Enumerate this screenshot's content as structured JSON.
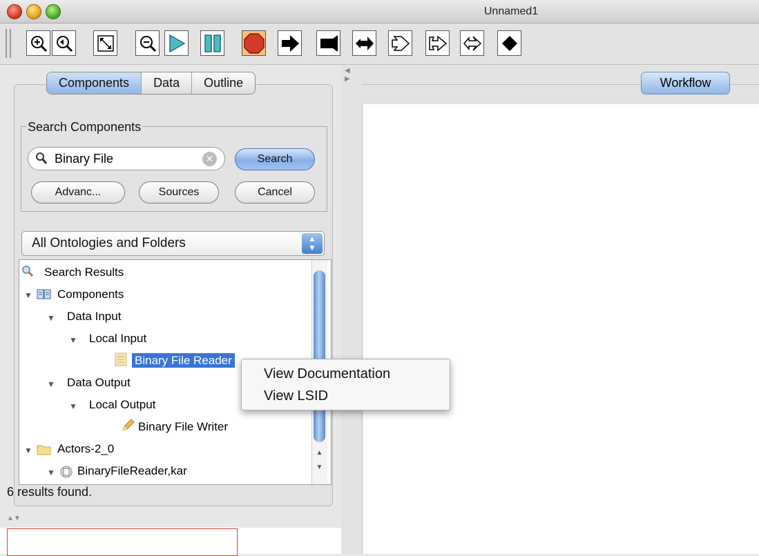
{
  "window": {
    "title": "Unnamed1"
  },
  "toolbar": {
    "buttons": [
      {
        "icon": "zoom-in-icon"
      },
      {
        "icon": "zoom-reset-icon"
      },
      {
        "icon": "zoom-fit-icon"
      },
      {
        "icon": "zoom-out-icon"
      },
      {
        "icon": "run-icon"
      },
      {
        "icon": "pause-icon"
      },
      {
        "icon": "stop-icon"
      },
      {
        "icon": "arrow-right-icon"
      },
      {
        "icon": "flag-icon"
      },
      {
        "icon": "arrow-double-icon"
      },
      {
        "icon": "outline-arrow-icon"
      },
      {
        "icon": "outline-arrow-flag-icon"
      },
      {
        "icon": "outline-double-arrow-icon"
      },
      {
        "icon": "diamond-icon"
      }
    ]
  },
  "left_panel": {
    "tabs": [
      "Components",
      "Data",
      "Outline"
    ],
    "selected_tab": "Components",
    "search": {
      "group_title": "Search Components",
      "value": "Binary File",
      "search_button": "Search",
      "advanced_button": "Advanc...",
      "sources_button": "Sources",
      "cancel_button": "Cancel"
    },
    "ontology_select": "All Ontologies and Folders",
    "tree": [
      {
        "label": "Search Results"
      },
      {
        "label": "Components"
      },
      {
        "label": "Data Input"
      },
      {
        "label": "Local Input"
      },
      {
        "label": "Binary File Reader"
      },
      {
        "label": "Data Output"
      },
      {
        "label": "Local Output"
      },
      {
        "label": "Binary File Writer"
      },
      {
        "label": "Actors-2_0"
      },
      {
        "label": "BinaryFileReader,kar"
      }
    ],
    "status": "6 results found."
  },
  "right_panel": {
    "tab": "Workflow"
  },
  "context_menu": {
    "items": [
      "View Documentation",
      "View LSID"
    ]
  },
  "colors": {
    "selection": "#3875d7",
    "accent_blue": "#8fb7e6",
    "stop_red": "#d63a2a"
  }
}
